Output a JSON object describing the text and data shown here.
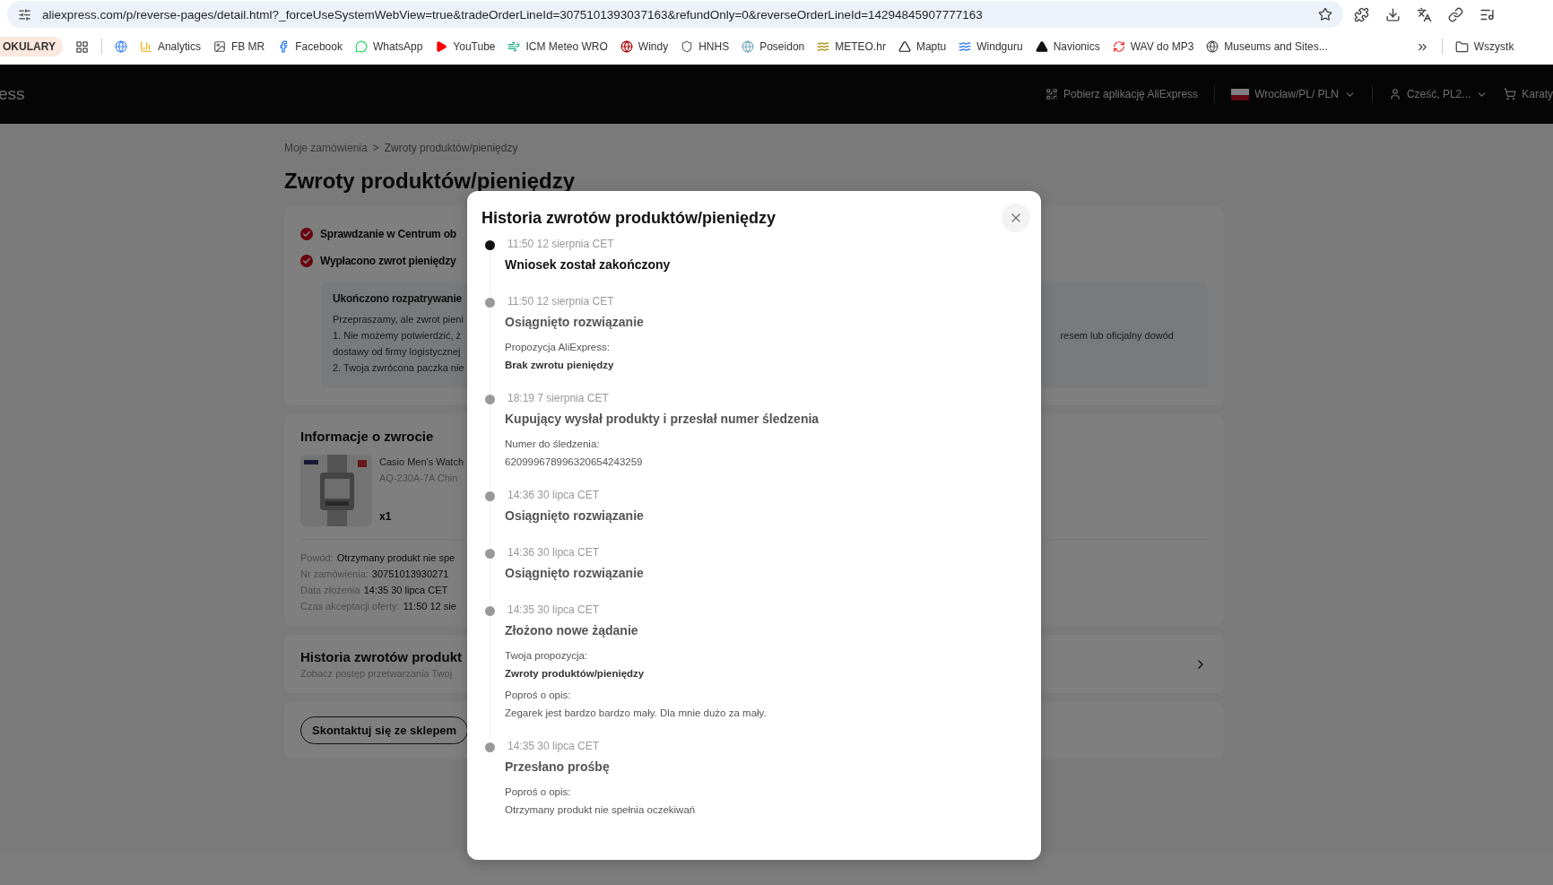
{
  "browser": {
    "url": "aliexpress.com/p/reverse-pages/detail.html?_forceUseSystemWebView=true&tradeOrderLineId=3075101393037163&refundOnly=0&reverseOrderLineId=14294845907777163",
    "bookmarks": [
      "Analytics",
      "FB MR",
      "Facebook",
      "WhatsApp",
      "YouTube",
      "ICM Meteo WRO",
      "Windy",
      "HNHS",
      "Poseidon",
      "METEO.hr",
      "Maptu",
      "Windguru",
      "Navionics",
      "WAV do MP3",
      "Museums and Sites..."
    ],
    "bookmark_group": "OKULARY",
    "folder": "Wszystk"
  },
  "header": {
    "logo": "ess",
    "app_link": "Pobierz aplikację AliExpress",
    "region": "Wrocław/PL/ PLN",
    "account": "Cześć, PL2...",
    "cart": "Karaty"
  },
  "breadcrumb": [
    "Moje zamówienia",
    "Zwroty produktów/pieniędzy"
  ],
  "breadcrumb_separator": ">",
  "page_title": "Zwroty produktów/pieniędzy",
  "steps": [
    {
      "label": "Sprawdzanie w Centrum ob",
      "done": true
    },
    {
      "label": "Wypłacono zwrot pieniędzy",
      "done": true
    }
  ],
  "result": {
    "title": "Ukończono rozpatrywanie",
    "lines": [
      {
        "left": "Przepraszamy, ale zwrot pieni"
      },
      {
        "left": "1. Nie możemy potwierdzić, ż",
        "right": "resem lub oficjalny dowód"
      },
      {
        "left": "dostawy od firmy logistycznej"
      },
      {
        "left": "2. Twoja zwrócona paczka nie"
      }
    ]
  },
  "return_info": {
    "title": "Informacje o zwrocie",
    "product": {
      "kind": "picture",
      "name": "Casio Men's Watch",
      "variant": "AQ-230A-7A Chin",
      "quantity": "x1"
    },
    "details": [
      {
        "label": "Powód:",
        "value": "Otrzymany produkt nie spe"
      },
      {
        "label": "Nr zamówienia:",
        "value": "30751013930271"
      },
      {
        "label": "Data złożenia",
        "value": "14:35 30 lipca CET"
      },
      {
        "label": "Czas akceptacji oferty:",
        "value": "11:50 12 sie"
      }
    ]
  },
  "history_link": {
    "title": "Historia zwrotów produkt",
    "subtitle": "Zobacz postęp przetwarzania Twoj"
  },
  "contact_button": "Skontaktuj się ze sklepem",
  "modal": {
    "title": "Historia zwrotów produktów/pieniędzy",
    "events": [
      {
        "time": "11:50 12 sierpnia CET",
        "title": "Wniosek został zakończony",
        "current": true
      },
      {
        "time": "11:50 12 sierpnia CET",
        "title": "Osiągnięto rozwiązanie",
        "current": false,
        "lines": [
          {
            "kind": "label",
            "text": "Propozycja AliExpress:"
          },
          {
            "kind": "strong",
            "text": "Brak zwrotu pieniędzy"
          }
        ]
      },
      {
        "time": "18:19 7 sierpnia CET",
        "title": "Kupujący wysłał produkty i przesłał numer śledzenia",
        "current": false,
        "lines": [
          {
            "kind": "label",
            "text": "Numer do śledzenia:"
          },
          {
            "kind": "text",
            "text": "620999678996320654243259"
          }
        ]
      },
      {
        "time": "14:36 30 lipca CET",
        "title": "Osiągnięto rozwiązanie",
        "current": false
      },
      {
        "time": "14:36 30 lipca CET",
        "title": "Osiągnięto rozwiązanie",
        "current": false
      },
      {
        "time": "14:35 30 lipca CET",
        "title": "Złożono nowe żądanie",
        "current": false,
        "lines": [
          {
            "kind": "label",
            "text": "Twoja propozycja:"
          },
          {
            "kind": "strong",
            "text": "Zwroty produktów/pieniędzy"
          },
          {
            "kind": "label",
            "text": "Poproś o opis:"
          },
          {
            "kind": "text",
            "text": "Zegarek jest bardzo bardzo mały. Dla mnie dużo za mały."
          }
        ]
      },
      {
        "time": "14:35 30 lipca CET",
        "title": "Przesłano prośbę",
        "current": false,
        "lines": [
          {
            "kind": "label",
            "text": "Poproś o opis:"
          },
          {
            "kind": "text",
            "text": "Otrzymany produkt nie spełnia oczekiwań"
          }
        ]
      }
    ]
  }
}
